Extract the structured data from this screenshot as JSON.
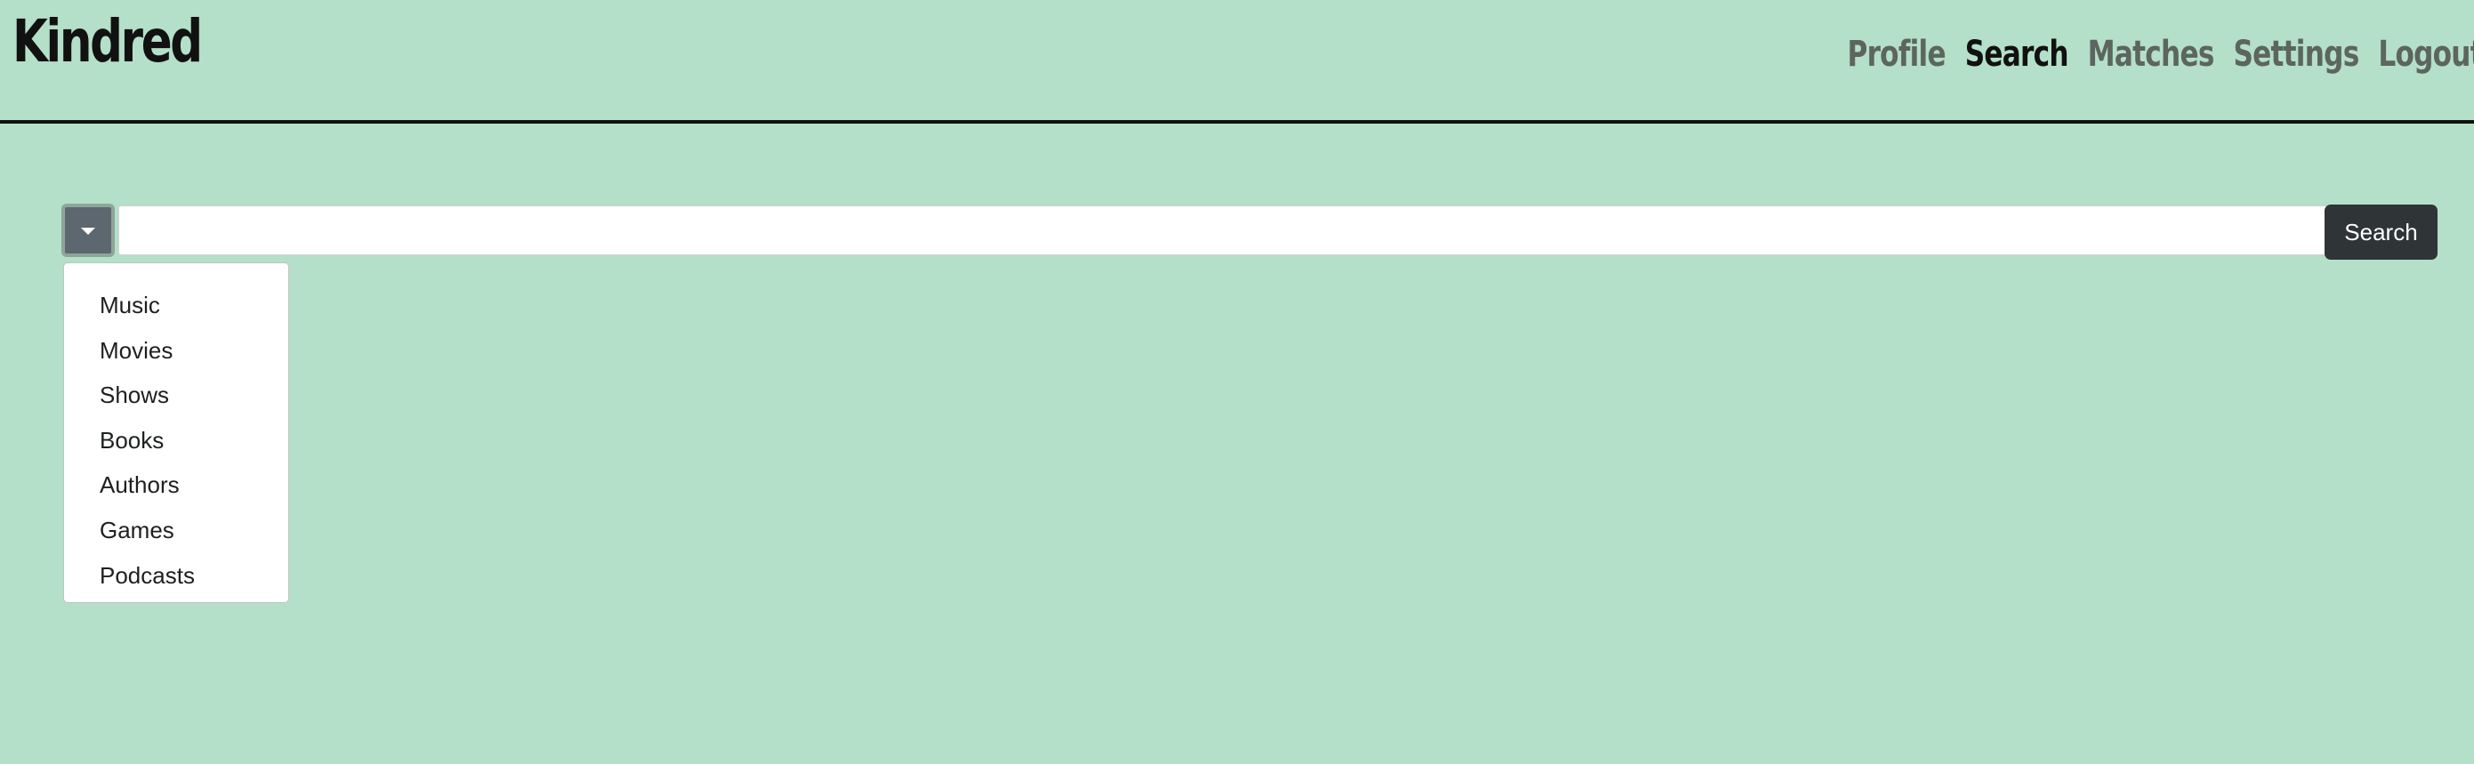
{
  "brand": "Kindred",
  "nav": {
    "items": [
      {
        "label": "Profile",
        "active": false
      },
      {
        "label": "Search",
        "active": true
      },
      {
        "label": "Matches",
        "active": false
      },
      {
        "label": "Settings",
        "active": false
      },
      {
        "label": "Logout",
        "active": false
      }
    ]
  },
  "search": {
    "value": "",
    "button_label": "Search"
  },
  "dropdown": {
    "items": [
      "Music",
      "Movies",
      "Shows",
      "Books",
      "Authors",
      "Games",
      "Podcasts"
    ]
  },
  "colors": {
    "background": "#b4dfc8",
    "toggle": "#5d676f",
    "button": "#2f3437",
    "nav_inactive": "#5c655f",
    "nav_active": "#111111"
  }
}
